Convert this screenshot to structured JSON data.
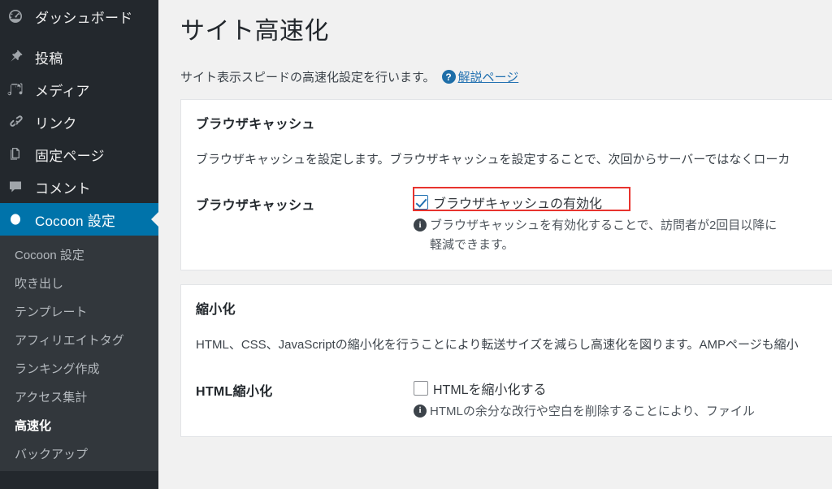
{
  "sidebar": {
    "items": [
      {
        "label": "ダッシュボード",
        "icon": "dashboard-icon",
        "active": false
      },
      {
        "label": "投稿",
        "icon": "pin-icon",
        "active": false
      },
      {
        "label": "メディア",
        "icon": "media-icon",
        "active": false
      },
      {
        "label": "リンク",
        "icon": "link-icon",
        "active": false
      },
      {
        "label": "固定ページ",
        "icon": "page-icon",
        "active": false
      },
      {
        "label": "コメント",
        "icon": "comment-icon",
        "active": false
      },
      {
        "label": "Cocoon 設定",
        "icon": "cocoon-icon",
        "active": true
      }
    ],
    "submenu": [
      {
        "label": "Cocoon 設定",
        "current": false
      },
      {
        "label": "吹き出し",
        "current": false
      },
      {
        "label": "テンプレート",
        "current": false
      },
      {
        "label": "アフィリエイトタグ",
        "current": false
      },
      {
        "label": "ランキング作成",
        "current": false
      },
      {
        "label": "アクセス集計",
        "current": false
      },
      {
        "label": "高速化",
        "current": true
      },
      {
        "label": "バックアップ",
        "current": false
      }
    ]
  },
  "page": {
    "title": "サイト高速化",
    "description": "サイト表示スピードの高速化設定を行います。",
    "help_icon": "question-icon",
    "help_link": "解説ページ"
  },
  "panels": [
    {
      "title": "ブラウザキャッシュ",
      "description": "ブラウザキャッシュを設定します。ブラウザキャッシュを設定することで、次回からサーバーではなくローカ",
      "field_label": "ブラウザキャッシュ",
      "checkbox_label": "ブラウザキャッシュの有効化",
      "checkbox_checked": true,
      "note": "ブラウザキャッシュを有効化することで、訪問者が2回目以降に\n軽減できます。",
      "note_icon": "info-icon",
      "highlighted": true
    },
    {
      "title": "縮小化",
      "description": "HTML、CSS、JavaScriptの縮小化を行うことにより転送サイズを減らし高速化を図ります。AMPページも縮小",
      "field_label": "HTML縮小化",
      "checkbox_label": "HTMLを縮小化する",
      "checkbox_checked": false,
      "note": "HTMLの余分な改行や空白を削除することにより、ファイル",
      "note_icon": "info-icon",
      "highlighted": false
    }
  ],
  "colors": {
    "sidebar_bg": "#23282d",
    "submenu_bg": "#32373c",
    "active_blue": "#0073aa",
    "link_blue": "#2271b1",
    "annotation_red": "#e8332e",
    "page_bg": "#f1f1f1"
  }
}
